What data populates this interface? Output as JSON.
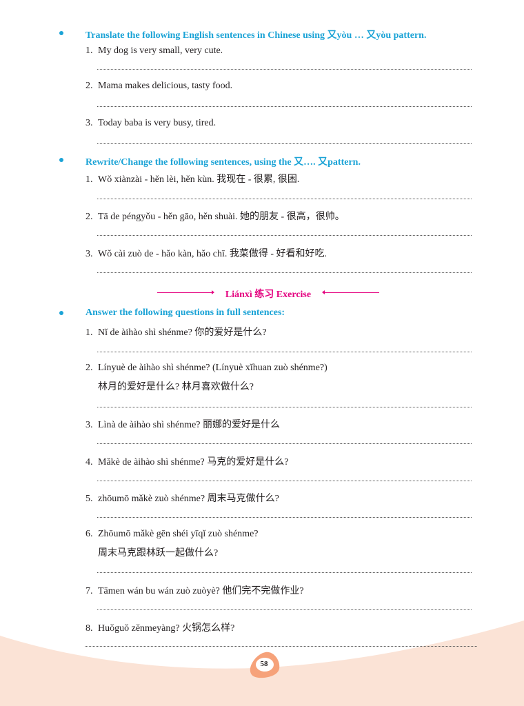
{
  "section1": {
    "heading": "Translate the following English sentences in Chinese using 又yòu … 又yòu pattern.",
    "items": [
      {
        "num": "1.",
        "text": "My dog is very small, very cute."
      },
      {
        "num": "2.",
        "text": "Mama makes delicious, tasty food."
      },
      {
        "num": "3.",
        "text": "Today baba is very busy, tired."
      }
    ]
  },
  "section2": {
    "heading": "Rewrite/Change the following sentences, using the 又…. 又pattern.",
    "items": [
      {
        "num": "1.",
        "text": "Wǒ xiànzài - hěn lèi, hěn kùn. 我现在 - 很累, 很困."
      },
      {
        "num": "2.",
        "text": "Tā de péngyǒu - hěn gāo, hěn shuài. 她的朋友 - 很高，很帅。"
      },
      {
        "num": "3.",
        "text": "Wǒ cài zuò de - hǎo kàn, hǎo chī.  我菜做得 - 好看和好吃."
      }
    ]
  },
  "exercise_title": "Liánxì 练习 Exercise",
  "section3": {
    "heading": "Answer the following questions in full sentences:",
    "items": [
      {
        "num": "1.",
        "text": "Nǐ de àihào shì shénme?  你的爱好是什么?",
        "line2": ""
      },
      {
        "num": "2.",
        "text": "Línyuè de àihào shì shénme? (Línyuè xǐhuan zuò shénme?)",
        "line2": "林月的爱好是什么? 林月喜欢做什么?"
      },
      {
        "num": "3.",
        "text": "Lìnà de àihào shì shénme?  丽娜的爱好是什么",
        "line2": ""
      },
      {
        "num": "4.",
        "text": "Mǎkè de àihào shì shénme?  马克的爱好是什么?",
        "line2": ""
      },
      {
        "num": "5.",
        "text": "zhōumō mǎkè zuò shénme?  周末马克做什么?",
        "line2": ""
      },
      {
        "num": "6.",
        "text": "Zhōumō mǎkè gēn shéi yīqǐ zuò shénme?",
        "line2": "周末马克跟林跃一起做什么?"
      },
      {
        "num": "7.",
        "text": "Tāmen wán bu wán zuò zuòyè?  他们完不完做作业?",
        "line2": ""
      },
      {
        "num": "8.",
        "text": "Huǒguǒ zěnmeyàng?  火锅怎么样?",
        "line2": ""
      }
    ]
  },
  "page_number": "58",
  "colors": {
    "heading": "#1ba3d6",
    "exercise": "#e4007f",
    "wave": "#fbe3d6",
    "badge": "#f6a27a"
  }
}
